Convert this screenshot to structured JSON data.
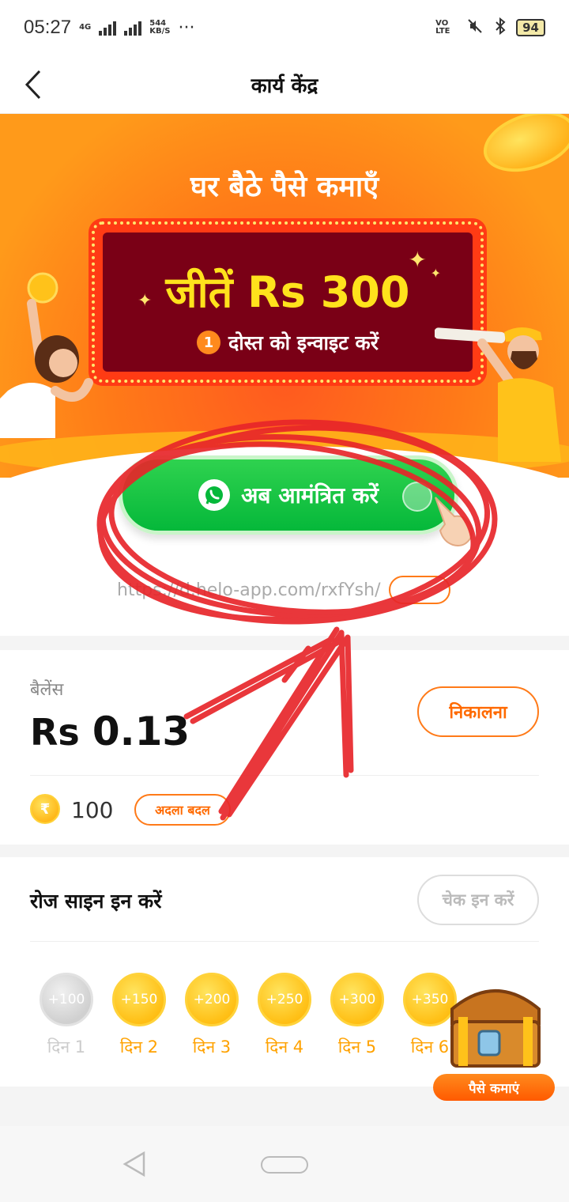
{
  "status_bar": {
    "time": "05:27",
    "network": "4G",
    "speed_value": "544",
    "speed_unit": "KB/S",
    "more": "···",
    "volte": "VO LTE",
    "battery": "94"
  },
  "header": {
    "title": "कार्य केंद्र"
  },
  "banner": {
    "headline": "घर बैठे पैसे कमाएँ",
    "win_text": "जीतें Rs 300",
    "invite_count": "1",
    "invite_text": "दोस्त को इन्वाइट करें",
    "invite_button": "अब आमंत्रित करें",
    "link": "https://d.helo-app.com/rxfYsh/"
  },
  "balance": {
    "label": "बैलेंस",
    "currency": "Rs",
    "amount": "0.13",
    "withdraw_button": "निकालना",
    "coin_symbol": "₹",
    "coins": "100",
    "exchange_button": "अदला बदल"
  },
  "signin": {
    "title": "रोज साइन इन करें",
    "checkin_button": "चेक इन करें",
    "days": [
      {
        "reward": "+100",
        "label": "दिन 1",
        "done": true
      },
      {
        "reward": "+150",
        "label": "दिन 2",
        "done": false
      },
      {
        "reward": "+200",
        "label": "दिन 3",
        "done": false
      },
      {
        "reward": "+250",
        "label": "दिन 4",
        "done": false
      },
      {
        "reward": "+300",
        "label": "दिन 5",
        "done": false
      },
      {
        "reward": "+350",
        "label": "दिन 6",
        "done": false
      }
    ],
    "earn_button": "पैसे कमाएं"
  },
  "colors": {
    "accent": "#ff6a00",
    "green": "#05b83a",
    "scribble": "#e8262a"
  }
}
